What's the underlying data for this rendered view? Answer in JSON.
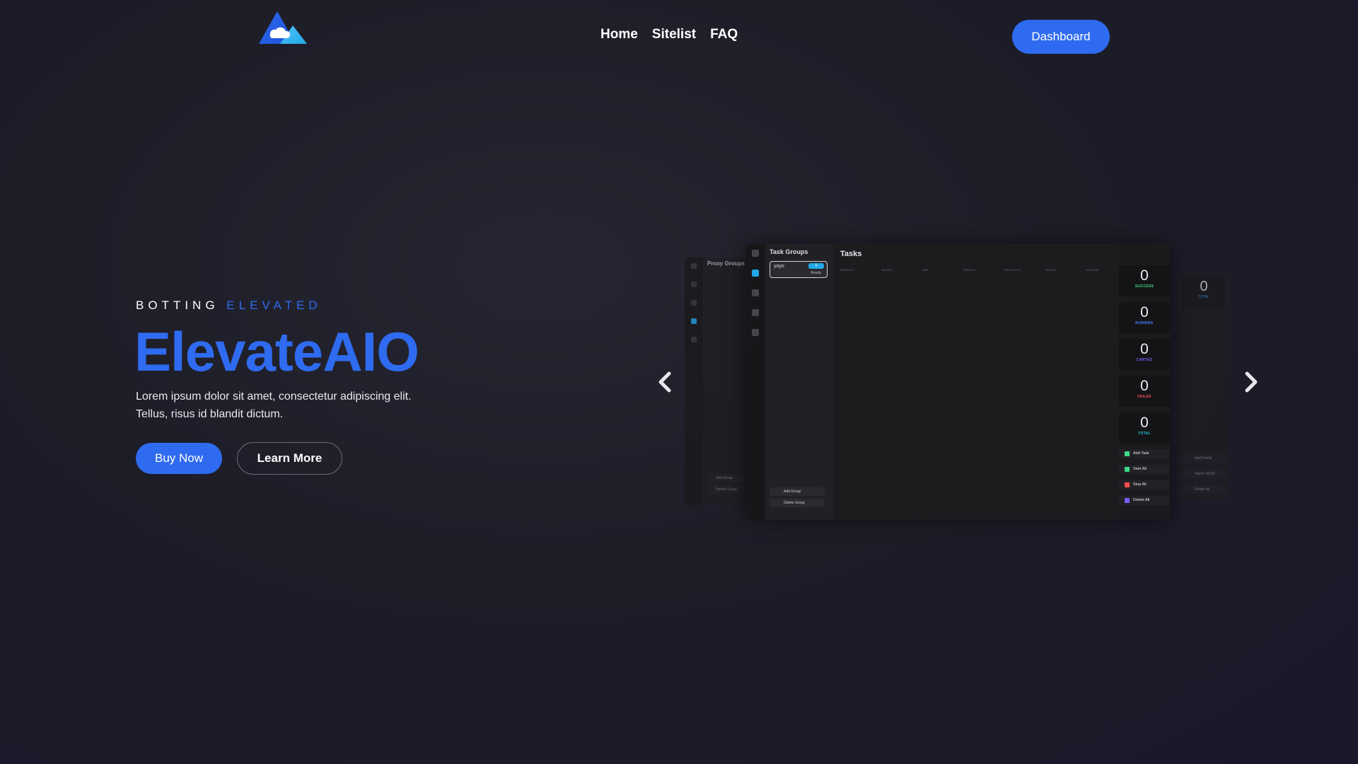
{
  "colors": {
    "accent": "#2f6bf0",
    "app_highlight": "#21a8e6",
    "success": "#3ddc84",
    "running": "#4a7dff",
    "carted": "#7b5cff",
    "failed": "#ff4d4f",
    "total": "#21c7d9"
  },
  "navbar": {
    "logo_icon": "cloud-mountain-logo-icon",
    "links": [
      {
        "label": "Home"
      },
      {
        "label": "Sitelist"
      },
      {
        "label": "FAQ"
      }
    ],
    "dashboard_label": "Dashboard"
  },
  "hero": {
    "eyebrow_white": "BOTTING",
    "eyebrow_blue": "ELEVATED",
    "title": "ElevateAIO",
    "description_line1": "Lorem ipsum dolor sit amet, consectetur adipiscing elit.",
    "description_line2": "Tellus, risus id blandit dictum.",
    "buy_label": "Buy Now",
    "learn_label": "Learn More"
  },
  "carousel": {
    "prev_icon": "chevron-left-icon",
    "next_icon": "chevron-right-icon",
    "back_left": {
      "title": "Proxy Groups",
      "add_label": "Add Group",
      "delete_label": "Delete Group"
    },
    "back_right": {
      "stat_value": "0",
      "stat_label": "TOTAL",
      "buttons": [
        "Add Profile",
        "Import JSON",
        "Delete All"
      ]
    },
    "main": {
      "groups_title": "Task Groups",
      "group_name": "yoyo",
      "group_badge": "0",
      "group_status": "Ready",
      "add_group": "Add Group",
      "delete_group": "Delete Group",
      "tasks_title": "Tasks",
      "columns": [
        "PRODUCT",
        "MISSITE",
        "SIZE",
        "PROFILE",
        "PROXY LIST",
        "STATUS",
        "ACTIONS"
      ],
      "stats": [
        {
          "value": "0",
          "label": "SUCCESS"
        },
        {
          "value": "0",
          "label": "RUNNING"
        },
        {
          "value": "0",
          "label": "CARTED"
        },
        {
          "value": "0",
          "label": "FAILED"
        },
        {
          "value": "0",
          "label": "TOTAL"
        }
      ],
      "actions": [
        "Add Task",
        "Start All",
        "Stop All",
        "Delete All"
      ]
    }
  }
}
